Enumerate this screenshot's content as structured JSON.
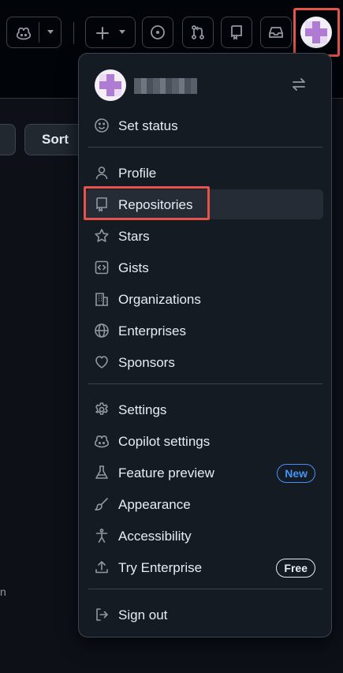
{
  "header": {
    "buttons": [
      {
        "name": "copilot-button",
        "icon": "copilot-icon"
      },
      {
        "name": "copilot-dropdown-button",
        "icon": "triangle-down-icon"
      },
      {
        "name": "create-new-button",
        "icon": "plus-icon"
      },
      {
        "name": "issues-button",
        "icon": "issue-opened-icon"
      },
      {
        "name": "pull-requests-button",
        "icon": "git-pull-request-icon"
      },
      {
        "name": "repositories-button",
        "icon": "repo-icon"
      },
      {
        "name": "inbox-button",
        "icon": "inbox-icon"
      }
    ],
    "avatar_color": "#f3eff7",
    "avatar_accent": "#b07cd3"
  },
  "background": {
    "sort_label": "Sort",
    "stray_text": "n"
  },
  "menu": {
    "user": {
      "switch_icon": "arrow-switch-icon"
    },
    "set_status": {
      "label": "Set status",
      "icon": "smiley-icon"
    },
    "section1": [
      {
        "label": "Profile",
        "icon": "person-icon"
      },
      {
        "label": "Repositories",
        "icon": "repo-icon"
      },
      {
        "label": "Stars",
        "icon": "star-icon"
      },
      {
        "label": "Gists",
        "icon": "code-square-icon"
      },
      {
        "label": "Organizations",
        "icon": "organization-icon"
      },
      {
        "label": "Enterprises",
        "icon": "globe-icon"
      },
      {
        "label": "Sponsors",
        "icon": "heart-icon"
      }
    ],
    "section2": [
      {
        "label": "Settings",
        "icon": "gear-icon"
      },
      {
        "label": "Copilot settings",
        "icon": "copilot-icon"
      },
      {
        "label": "Feature preview",
        "icon": "beaker-icon",
        "badge": "New"
      },
      {
        "label": "Appearance",
        "icon": "paintbrush-icon"
      },
      {
        "label": "Accessibility",
        "icon": "accessibility-icon"
      },
      {
        "label": "Try Enterprise",
        "icon": "upload-icon",
        "badge": "Free"
      }
    ],
    "sign_out": {
      "label": "Sign out",
      "icon": "sign-out-icon"
    }
  },
  "colors": {
    "highlight": "#e5534b",
    "badge_new": "#4493f8"
  }
}
